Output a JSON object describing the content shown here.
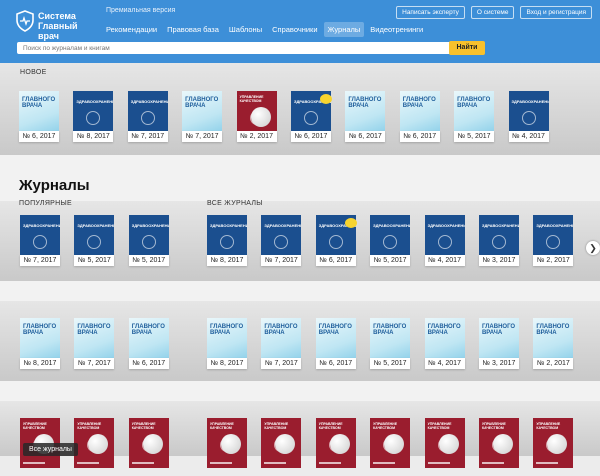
{
  "header": {
    "logo_text": "Система\nГлавный врач",
    "premium": "Премиальная версия",
    "nav": [
      "Рекомендации",
      "Правовая база",
      "Шаблоны",
      "Справочники",
      "Журналы",
      "Видеотренинги"
    ],
    "active_nav": 4,
    "buttons": [
      "Написать эксперту",
      "О системе",
      "Вход и регистрация"
    ]
  },
  "search": {
    "placeholder": "Поиск по журналам и книгам",
    "button": "Найти"
  },
  "sections": {
    "new": "НОВОЕ",
    "journals_title": "Журналы",
    "popular": "ПОПУЛЯРНЫЕ",
    "all": "ВСЕ ЖУРНАЛЫ"
  },
  "new_row": [
    {
      "type": "gv",
      "title": "ГЛАВНОГО\nВРАЧА",
      "issue": "№ 6, 2017"
    },
    {
      "type": "zd",
      "title": "ЗДРАВООХРАНЕНИЕ",
      "issue": "№ 8, 2017"
    },
    {
      "type": "zd",
      "title": "ЗДРАВООХРАНЕНИЕ",
      "issue": "№ 7, 2017"
    },
    {
      "type": "gv",
      "title": "ГЛАВНОГО\nВРАЧА",
      "issue": "№ 7, 2017"
    },
    {
      "type": "uk",
      "title": "УПРАВЛЕНИЕ\nКАЧЕСТВОМ",
      "issue": "№ 2, 2017"
    },
    {
      "type": "zd",
      "title": "ЗДРАВООХРАНЕНИЕ",
      "issue": "№ 6, 2017",
      "hot": true
    },
    {
      "type": "gv",
      "title": "ГЛАВНОГО\nВРАЧА",
      "issue": "№ 6, 2017"
    },
    {
      "type": "gv",
      "title": "ГЛАВНОГО\nВРАЧА",
      "issue": "№ 6, 2017"
    },
    {
      "type": "gv",
      "title": "ГЛАВНОГО\nВРАЧА",
      "issue": "№ 5, 2017"
    },
    {
      "type": "zd",
      "title": "ЗДРАВООХРАНЕНИЕ",
      "issue": "№ 4, 2017"
    }
  ],
  "popular_row1": [
    {
      "type": "zd",
      "title": "ЗДРАВООХРАНЕНИЕ",
      "issue": "№ 7, 2017"
    },
    {
      "type": "zd",
      "title": "ЗДРАВООХРАНЕНИЕ",
      "issue": "№ 5, 2017"
    },
    {
      "type": "zd",
      "title": "ЗДРАВООХРАНЕНИЕ",
      "issue": "№ 5, 2017"
    }
  ],
  "all_row1": [
    {
      "type": "zd",
      "title": "ЗДРАВООХРАНЕНИЕ",
      "issue": "№ 8, 2017"
    },
    {
      "type": "zd",
      "title": "ЗДРАВООХРАНЕНИЕ",
      "issue": "№ 7, 2017"
    },
    {
      "type": "zd",
      "title": "ЗДРАВООХРАНЕНИЕ",
      "issue": "№ 6, 2017",
      "hot": true
    },
    {
      "type": "zd",
      "title": "ЗДРАВООХРАНЕНИЕ",
      "issue": "№ 5, 2017"
    },
    {
      "type": "zd",
      "title": "ЗДРАВООХРАНЕНИЕ",
      "issue": "№ 4, 2017"
    },
    {
      "type": "zd",
      "title": "ЗДРАВООХРАНЕНИЕ",
      "issue": "№ 3, 2017"
    },
    {
      "type": "zd",
      "title": "ЗДРАВООХРАНЕНИЕ",
      "issue": "№ 2, 2017"
    }
  ],
  "popular_row2": [
    {
      "type": "gv",
      "title": "ГЛАВНОГО\nВРАЧА",
      "issue": "№ 8, 2017"
    },
    {
      "type": "gv",
      "title": "ГЛАВНОГО\nВРАЧА",
      "issue": "№ 7, 2017"
    },
    {
      "type": "gv",
      "title": "ГЛАВНОГО\nВРАЧА",
      "issue": "№ 6, 2017"
    }
  ],
  "all_row2": [
    {
      "type": "gv",
      "title": "ГЛАВНОГО\nВРАЧА",
      "issue": "№ 8, 2017"
    },
    {
      "type": "gv",
      "title": "ГЛАВНОГО\nВРАЧА",
      "issue": "№ 7, 2017"
    },
    {
      "type": "gv",
      "title": "ГЛАВНОГО\nВРАЧА",
      "issue": "№ 6, 2017"
    },
    {
      "type": "gv",
      "title": "ГЛАВНОГО\nВРАЧА",
      "issue": "№ 5, 2017"
    },
    {
      "type": "gv",
      "title": "ГЛАВНОГО\nВРАЧА",
      "issue": "№ 4, 2017"
    },
    {
      "type": "gv",
      "title": "ГЛАВНОГО\nВРАЧА",
      "issue": "№ 3, 2017"
    },
    {
      "type": "gv",
      "title": "ГЛАВНОГО\nВРАЧА",
      "issue": "№ 2, 2017"
    }
  ],
  "popular_row3": [
    {
      "type": "uk",
      "title": "УПРАВЛЕНИЕ\nКАЧЕСТВОМ",
      "issue": ""
    },
    {
      "type": "uk",
      "title": "УПРАВЛЕНИЕ\nКАЧЕСТВОМ",
      "issue": ""
    },
    {
      "type": "uk",
      "title": "УПРАВЛЕНИЕ\nКАЧЕСТВОМ",
      "issue": ""
    }
  ],
  "all_row3": [
    {
      "type": "uk",
      "title": "УПРАВЛЕНИЕ\nКАЧЕСТВОМ",
      "issue": ""
    },
    {
      "type": "uk",
      "title": "УПРАВЛЕНИЕ\nКАЧЕСТВОМ",
      "issue": ""
    },
    {
      "type": "uk",
      "title": "УПРАВЛЕНИЕ\nКАЧЕСТВОМ",
      "issue": ""
    },
    {
      "type": "uk",
      "title": "УПРАВЛЕНИЕ\nКАЧЕСТВОМ",
      "issue": ""
    },
    {
      "type": "uk",
      "title": "УПРАВЛЕНИЕ\nКАЧЕСТВОМ",
      "issue": ""
    },
    {
      "type": "uk",
      "title": "УПРАВЛЕНИЕ\nКАЧЕСТВОМ",
      "issue": ""
    },
    {
      "type": "uk",
      "title": "УПРАВЛЕНИЕ\nКАЧЕСТВОМ",
      "issue": ""
    }
  ],
  "all_journals_button": "Все журналы",
  "icons": {
    "logo": "shield-pulse-icon",
    "next": "chevron-right-icon"
  }
}
